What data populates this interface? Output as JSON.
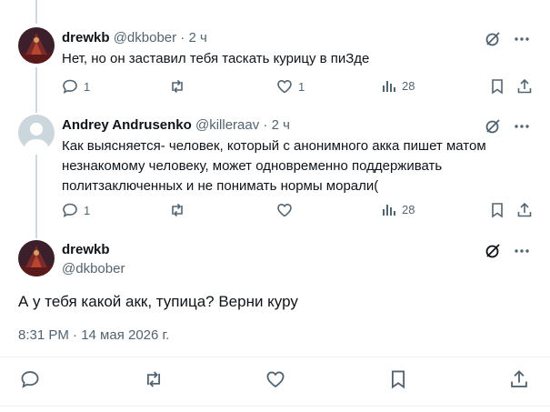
{
  "replies": [
    {
      "name": "drewkb",
      "handle": "@dkbober",
      "dot": "·",
      "time": "2 ч",
      "text": "Нет, но он заставил тебя таскать курицу в пиЗде",
      "reply_count": "1",
      "retweet_count": "",
      "like_count": "1",
      "view_count": "28"
    },
    {
      "name": "Andrey Andrusenko",
      "handle": "@killeraav",
      "dot": "·",
      "time": "2 ч",
      "text": "Как выясняется- человек, который с анонимного акка пишет матом незнакомому человеку, может одновременно поддерживать политзаключенных и не понимать нормы морали(",
      "reply_count": "1",
      "retweet_count": "",
      "like_count": "",
      "view_count": "28"
    }
  ],
  "main_tweet": {
    "name": "drewkb",
    "handle": "@dkbober",
    "text": "А у тебя какой акк, тупица? Верни куру",
    "timestamp": "8:31 PM · 14 мая 2026 г."
  },
  "icons": {
    "grok": "grok-slash-icon",
    "more": "more-dots-icon",
    "reply": "reply-bubble-icon",
    "retweet": "retweet-icon",
    "like": "heart-icon",
    "views": "views-bar-icon",
    "bookmark": "bookmark-icon",
    "share": "share-upload-icon"
  },
  "colors": {
    "text": "#0f1419",
    "secondary": "#536471",
    "thread_line": "#cfd9de",
    "divider": "#eff3f4"
  }
}
